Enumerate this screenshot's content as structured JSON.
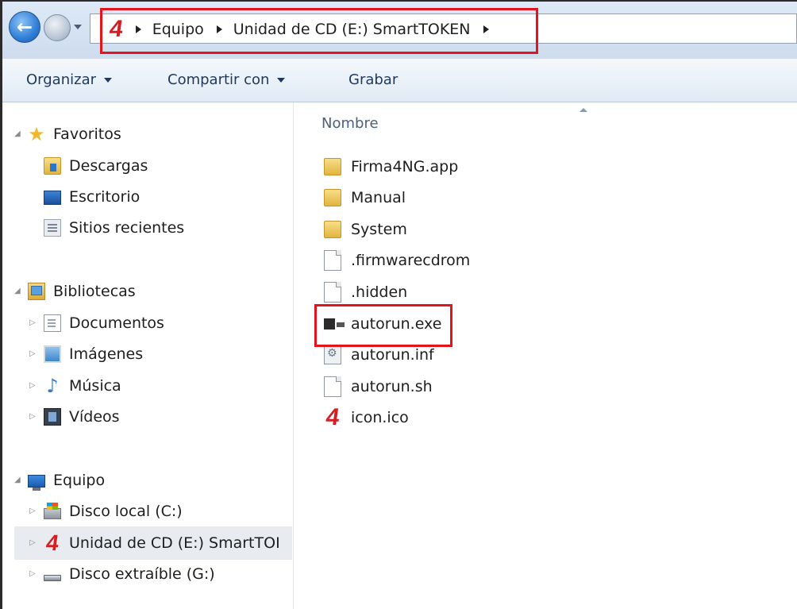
{
  "address_bar": {
    "crumbs": [
      "Equipo",
      "Unidad de CD (E:) SmartTOKEN"
    ],
    "logo_text": "4"
  },
  "toolbar": {
    "organize_label": "Organizar",
    "share_label": "Compartir con",
    "burn_label": "Grabar"
  },
  "nav": {
    "favorites": {
      "label": "Favoritos",
      "items": [
        "Descargas",
        "Escritorio",
        "Sitios recientes"
      ]
    },
    "libraries": {
      "label": "Bibliotecas",
      "items": [
        "Documentos",
        "Imágenes",
        "Música",
        "Vídeos"
      ]
    },
    "computer": {
      "label": "Equipo",
      "items": [
        "Disco local (C:)",
        "Unidad de CD (E:) SmartTOI",
        "Disco extraíble (G:)"
      ],
      "selected_index": 1
    }
  },
  "files": {
    "column_header": "Nombre",
    "items": [
      {
        "name": "Firma4NG.app",
        "icon": "folder-icon"
      },
      {
        "name": "Manual",
        "icon": "folder-icon"
      },
      {
        "name": "System",
        "icon": "folder-icon"
      },
      {
        "name": ".firmwarecdrom",
        "icon": "file-icon"
      },
      {
        "name": ".hidden",
        "icon": "file-icon"
      },
      {
        "name": "autorun.exe",
        "icon": "exe-icon"
      },
      {
        "name": "autorun.inf",
        "icon": "config-file-icon"
      },
      {
        "name": "autorun.sh",
        "icon": "file-icon"
      },
      {
        "name": "icon.ico",
        "icon": "brand-4-icon"
      }
    ],
    "highlighted": "autorun.exe"
  },
  "colors": {
    "highlight": "#e3141b",
    "brand": "#d71d24"
  }
}
